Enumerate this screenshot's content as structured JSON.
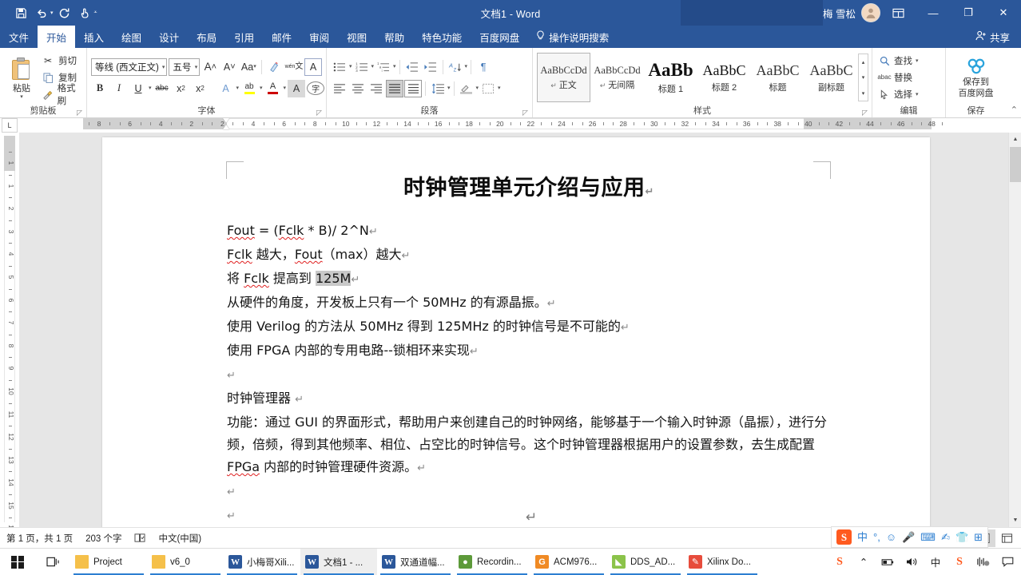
{
  "titlebar": {
    "quick_access": [
      {
        "name": "save",
        "glyph": "save-icon"
      },
      {
        "name": "undo",
        "glyph": "undo-icon"
      },
      {
        "name": "redo",
        "glyph": "redo-icon"
      },
      {
        "name": "touch-mode",
        "glyph": "touch-icon"
      },
      {
        "name": "customize-qat",
        "glyph": "chevron-down-icon"
      }
    ],
    "title": "文档1 - Word",
    "account_name": "梅 雪松",
    "avatar_glyph": "person-icon",
    "ribbon_display_options": "▣",
    "minimize": "—",
    "restore": "❐",
    "close": "✕"
  },
  "tabs": [
    {
      "label": "文件",
      "active": false
    },
    {
      "label": "开始",
      "active": true
    },
    {
      "label": "插入",
      "active": false
    },
    {
      "label": "绘图",
      "active": false
    },
    {
      "label": "设计",
      "active": false
    },
    {
      "label": "布局",
      "active": false
    },
    {
      "label": "引用",
      "active": false
    },
    {
      "label": "邮件",
      "active": false
    },
    {
      "label": "审阅",
      "active": false
    },
    {
      "label": "视图",
      "active": false
    },
    {
      "label": "帮助",
      "active": false
    },
    {
      "label": "特色功能",
      "active": false
    },
    {
      "label": "百度网盘",
      "active": false
    }
  ],
  "tell_me": "操作说明搜索",
  "share": "共享",
  "ribbon": {
    "clipboard": {
      "group_label": "剪贴板",
      "paste_label": "粘贴",
      "items": [
        {
          "label": "剪切",
          "icon": "scissors-icon"
        },
        {
          "label": "复制",
          "icon": "copy-icon"
        },
        {
          "label": "格式刷",
          "icon": "format-painter-icon"
        }
      ]
    },
    "font": {
      "group_label": "字体",
      "font_name": "等线 (西文正文)",
      "font_size": "五号",
      "buttons_row1": [
        {
          "label": "A",
          "name": "grow-font"
        },
        {
          "label": "A",
          "name": "shrink-font"
        },
        {
          "label": "Aa",
          "name": "change-case"
        },
        {
          "label": "",
          "name": "clear-formatting"
        },
        {
          "label": "文",
          "name": "phonetic-guide"
        },
        {
          "label": "A",
          "name": "character-border"
        }
      ],
      "buttons_row2": [
        {
          "label": "B",
          "name": "bold"
        },
        {
          "label": "I",
          "name": "italic"
        },
        {
          "label": "U",
          "name": "underline"
        },
        {
          "label": "abc",
          "name": "strikethrough"
        },
        {
          "label": "x₂",
          "name": "subscript"
        },
        {
          "label": "x²",
          "name": "superscript"
        },
        {
          "label": "A",
          "name": "text-effects"
        },
        {
          "label": "ab",
          "name": "text-highlight"
        },
        {
          "label": "A",
          "name": "font-color"
        },
        {
          "label": "A",
          "name": "character-shading"
        },
        {
          "label": "字",
          "name": "enclose-characters"
        }
      ]
    },
    "paragraph": {
      "group_label": "段落",
      "row1": [
        {
          "name": "bullets"
        },
        {
          "name": "numbering"
        },
        {
          "name": "multilevel-list"
        },
        {
          "name": "decrease-indent"
        },
        {
          "name": "increase-indent"
        },
        {
          "name": "sort"
        },
        {
          "name": "show-formatting-marks"
        }
      ],
      "row2": [
        {
          "name": "align-left"
        },
        {
          "name": "align-center"
        },
        {
          "name": "align-right"
        },
        {
          "name": "justify"
        },
        {
          "name": "distributed"
        },
        {
          "name": "line-spacing"
        },
        {
          "name": "shading"
        },
        {
          "name": "borders"
        }
      ]
    },
    "styles": {
      "group_label": "样式",
      "items": [
        {
          "preview": "AaBbCcDd",
          "name": "正文",
          "mark": "↵",
          "type": "body",
          "selected": true
        },
        {
          "preview": "AaBbCcDd",
          "name": "无间隔",
          "mark": "↵",
          "type": "body",
          "selected": false
        },
        {
          "preview": "AaBb",
          "name": "标题 1",
          "mark": "",
          "type": "h1",
          "selected": false
        },
        {
          "preview": "AaBbC",
          "name": "标题 2",
          "mark": "",
          "type": "h2",
          "selected": false
        },
        {
          "preview": "AaBbC",
          "name": "标题",
          "mark": "",
          "type": "t",
          "selected": false
        },
        {
          "preview": "AaBbC",
          "name": "副标题",
          "mark": "",
          "type": "st",
          "selected": false
        }
      ]
    },
    "editing": {
      "group_label": "编辑",
      "items": [
        {
          "label": "查找",
          "icon": "search-icon",
          "caret": true
        },
        {
          "label": "替换",
          "icon": "replace-icon",
          "caret": false
        },
        {
          "label": "选择",
          "icon": "select-icon",
          "caret": true
        }
      ]
    },
    "baidu": {
      "group_label": "保存",
      "button_line1": "保存到",
      "button_line2": "百度网盘",
      "icon": "baidu-netdisk-icon"
    },
    "collapse_icon": "chevron-up-icon"
  },
  "rulers": {
    "corner_tab_label": "L",
    "horizontal_numbers": [
      "8",
      "6",
      "4",
      "2",
      "2",
      "4",
      "6",
      "8",
      "10",
      "12",
      "14",
      "16",
      "18",
      "20",
      "22",
      "24",
      "26",
      "28",
      "30",
      "32",
      "34",
      "36",
      "38",
      "40",
      "42",
      "44",
      "46",
      "48"
    ],
    "vertical_numbers": [
      "1",
      "1",
      "2",
      "3",
      "4",
      "5",
      "6",
      "7",
      "8",
      "9",
      "10",
      "11",
      "12",
      "13",
      "14",
      "15",
      "16"
    ]
  },
  "document": {
    "title": "时钟管理单元介绍与应用",
    "paragraphs": [
      {
        "id": "p1",
        "segments": [
          {
            "text": "Fout",
            "squiggly": true
          },
          {
            "text": " = (",
            "squiggly": false
          },
          {
            "text": "Fclk",
            "squiggly": true
          },
          {
            "text": " * B)/ 2^N",
            "squiggly": false
          }
        ]
      },
      {
        "id": "p2",
        "segments": [
          {
            "text": "Fclk",
            "squiggly": true
          },
          {
            "text": " 越大，",
            "squiggly": false
          },
          {
            "text": "Fout",
            "squiggly": true
          },
          {
            "text": "（max）越大",
            "squiggly": false
          }
        ]
      },
      {
        "id": "p3",
        "segments": [
          {
            "text": "将 ",
            "squiggly": false
          },
          {
            "text": "Fclk",
            "squiggly": true
          },
          {
            "text": " 提高到 ",
            "squiggly": false
          },
          {
            "text": "125M",
            "squiggly": false,
            "selected": true
          }
        ]
      },
      {
        "id": "p4",
        "segments": [
          {
            "text": "从硬件的角度，开发板上只有一个 50MHz 的有源晶振。",
            "squiggly": false
          }
        ]
      },
      {
        "id": "p5",
        "segments": [
          {
            "text": "使用 Verilog 的方法从 50MHz 得到 125MHz 的时钟信号是不可能的",
            "squiggly": false
          }
        ]
      },
      {
        "id": "p6",
        "segments": [
          {
            "text": "使用 FPGA 内部的专用电路--锁相环来实现",
            "squiggly": false
          }
        ]
      },
      {
        "id": "p7",
        "segments": []
      },
      {
        "id": "p8",
        "segments": [
          {
            "text": "时钟管理器 ",
            "squiggly": false
          }
        ]
      },
      {
        "id": "p9",
        "segments": [
          {
            "text": "功能：通过 GUI 的界面形式，帮助用户来创建自己的时钟网络，能够基于一个输入时钟源（晶振），进行分频，倍频，得到其他频率、相位、占空比的时钟信号。这个时钟管理器根据用户的设置参数，去生成配置 ",
            "squiggly": false
          },
          {
            "text": "FPGa",
            "squiggly": true
          },
          {
            "text": " 内部的时钟管理硬件资源。",
            "squiggly": false
          }
        ]
      },
      {
        "id": "p10",
        "segments": []
      },
      {
        "id": "p11",
        "segments": []
      }
    ],
    "pilcrow": "↵",
    "end_mark": "↵"
  },
  "statusbar": {
    "page_info": "第 1 页，共 1 页",
    "word_count": "203 个字",
    "proofing_icon": "proofing-icon",
    "language": "中文(中国)",
    "view_buttons": [
      {
        "name": "read-mode",
        "glyph": "📖",
        "active": false
      },
      {
        "name": "print-layout",
        "glyph": "▤",
        "active": true
      },
      {
        "name": "web-layout",
        "glyph": "▥",
        "active": false
      }
    ]
  },
  "ime": {
    "logo": "S",
    "items": [
      "中",
      "°,",
      "☺",
      "🎤",
      "⌨",
      "✍",
      "👕",
      "⊞"
    ]
  },
  "taskbar": {
    "start_icon": "windows-start-icon",
    "task_view_icon": "task-view-icon",
    "apps": [
      {
        "label": "Project",
        "icon": "folder",
        "running": true,
        "active": false
      },
      {
        "label": "v6_0",
        "icon": "folder",
        "running": true,
        "active": false
      },
      {
        "label": "小梅哥Xili...",
        "icon": "word",
        "running": true,
        "active": false
      },
      {
        "label": "文档1 - ...",
        "icon": "word",
        "running": true,
        "active": true
      },
      {
        "label": "双通道幅...",
        "icon": "word",
        "running": true,
        "active": false
      },
      {
        "label": "Recordin...",
        "icon": "rec",
        "running": true,
        "active": false
      },
      {
        "label": "ACM976...",
        "icon": "acm",
        "running": true,
        "active": false
      },
      {
        "label": "DDS_AD...",
        "icon": "dds",
        "running": true,
        "active": false
      },
      {
        "label": "Xilinx Do...",
        "icon": "xil",
        "running": true,
        "active": false
      }
    ],
    "tray": [
      {
        "name": "sogou-overlay-icon",
        "glyph": "S",
        "style": "sogou"
      },
      {
        "name": "show-hidden-icons",
        "glyph": "⌃",
        "style": "dark"
      },
      {
        "name": "battery-icon",
        "glyph": "🔋",
        "style": "dark"
      },
      {
        "name": "volume-icon",
        "glyph": "🔊",
        "style": "dark"
      },
      {
        "name": "ime-indicator-icon",
        "glyph": "中",
        "style": "dark"
      },
      {
        "name": "sogou-pinyin-icon",
        "glyph": "S",
        "style": "sogou"
      },
      {
        "name": "recorder-icon",
        "glyph": "▮▯",
        "style": "dark"
      },
      {
        "name": "action-center-icon",
        "glyph": "🗨",
        "style": "dark"
      }
    ]
  },
  "colors": {
    "word_blue": "#2b579a",
    "canvas_gray": "#e6e6e6",
    "accent_orange": "#ff5a1f",
    "squiggly_red": "#e02020",
    "selection_gray": "#c9c9c9"
  }
}
